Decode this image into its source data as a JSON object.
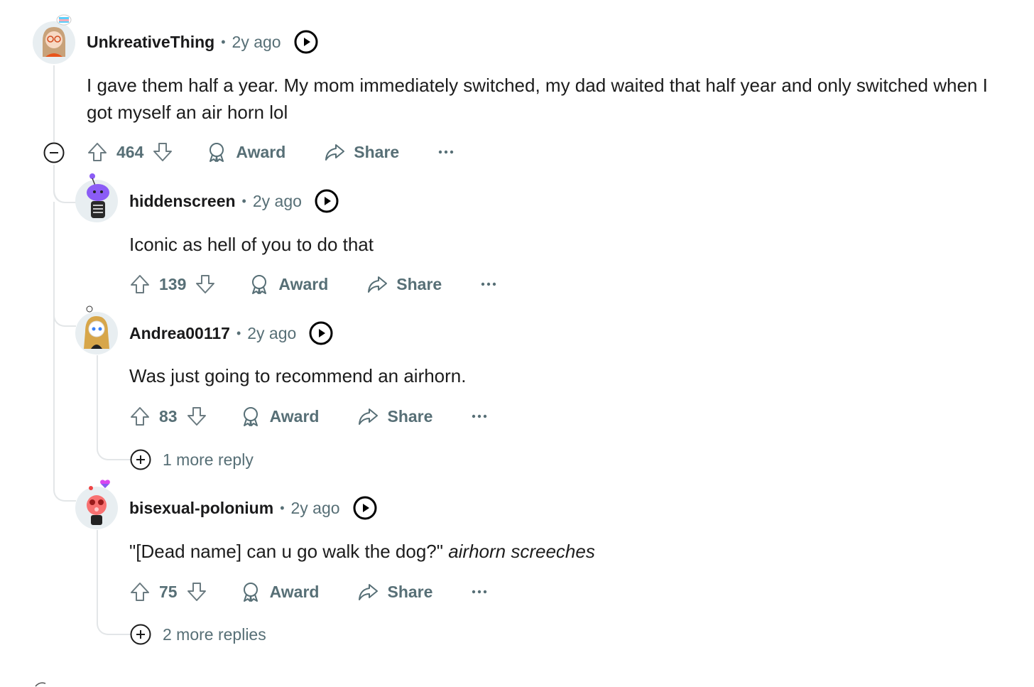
{
  "comments": [
    {
      "author": "UnkreativeThing",
      "separator": "•",
      "time": "2y ago",
      "body": "I gave them half a year. My mom immediately switched, my dad waited that half year and only switched when I got myself an air horn lol",
      "score": "464",
      "award_label": "Award",
      "share_label": "Share",
      "avatar_icon": "avatar-girl-glasses-icon"
    },
    {
      "author": "hiddenscreen",
      "separator": "•",
      "time": "2y ago",
      "body": "Iconic as hell of you to do that",
      "score": "139",
      "award_label": "Award",
      "share_label": "Share",
      "avatar_icon": "avatar-skeleton-icon"
    },
    {
      "author": "Andrea00117",
      "separator": "•",
      "time": "2y ago",
      "body": "Was just going to recommend an airhorn.",
      "score": "83",
      "award_label": "Award",
      "share_label": "Share",
      "more_replies": "1 more reply",
      "avatar_icon": "avatar-blonde-girl-icon"
    },
    {
      "author": "bisexual-polonium",
      "separator": "•",
      "time": "2y ago",
      "body_plain": "\"[Dead name] can u go walk the dog?\" ",
      "body_italic": "airhorn screeches",
      "score": "75",
      "award_label": "Award",
      "share_label": "Share",
      "more_replies": "2 more replies",
      "avatar_icon": "avatar-heart-icon"
    }
  ],
  "colors": {
    "muted": "#576f76",
    "thread_line": "#e3e6e8",
    "text": "#1c1c1c"
  }
}
